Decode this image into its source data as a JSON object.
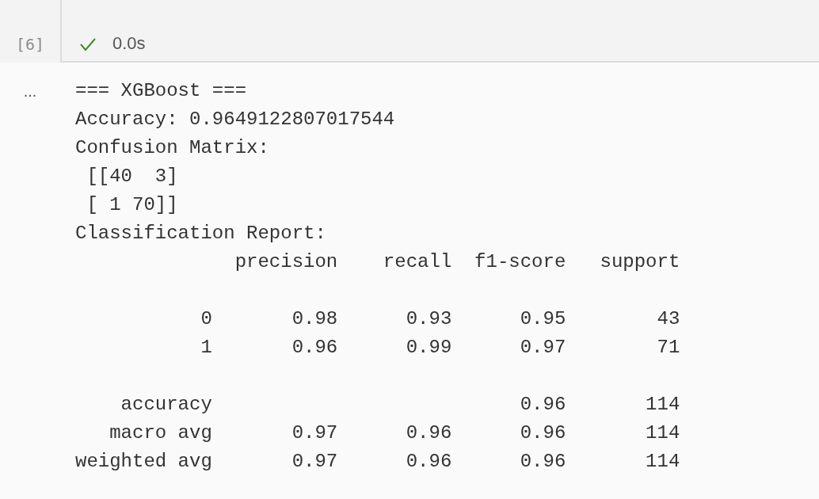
{
  "cell": {
    "execution_count": "[6]",
    "succeeded": true,
    "duration": "0.0s"
  },
  "output": {
    "prompt": "...",
    "lines": [
      "=== XGBoost ===",
      "Accuracy: 0.9649122807017544",
      "Confusion Matrix:",
      " [[40  3]",
      " [ 1 70]]",
      "Classification Report:"
    ],
    "report": {
      "columns": [
        "precision",
        "recall",
        "f1-score",
        "support"
      ],
      "groups": [
        [
          {
            "label": "0",
            "cells": [
              "0.98",
              "0.93",
              "0.95",
              "43"
            ]
          },
          {
            "label": "1",
            "cells": [
              "0.96",
              "0.99",
              "0.97",
              "71"
            ]
          }
        ],
        [
          {
            "label": "accuracy",
            "cells": [
              null,
              null,
              "0.96",
              "114"
            ]
          },
          {
            "label": "macro avg",
            "cells": [
              "0.97",
              "0.96",
              "0.96",
              "114"
            ]
          },
          {
            "label": "weighted avg",
            "cells": [
              "0.97",
              "0.96",
              "0.96",
              "114"
            ]
          }
        ]
      ]
    }
  }
}
